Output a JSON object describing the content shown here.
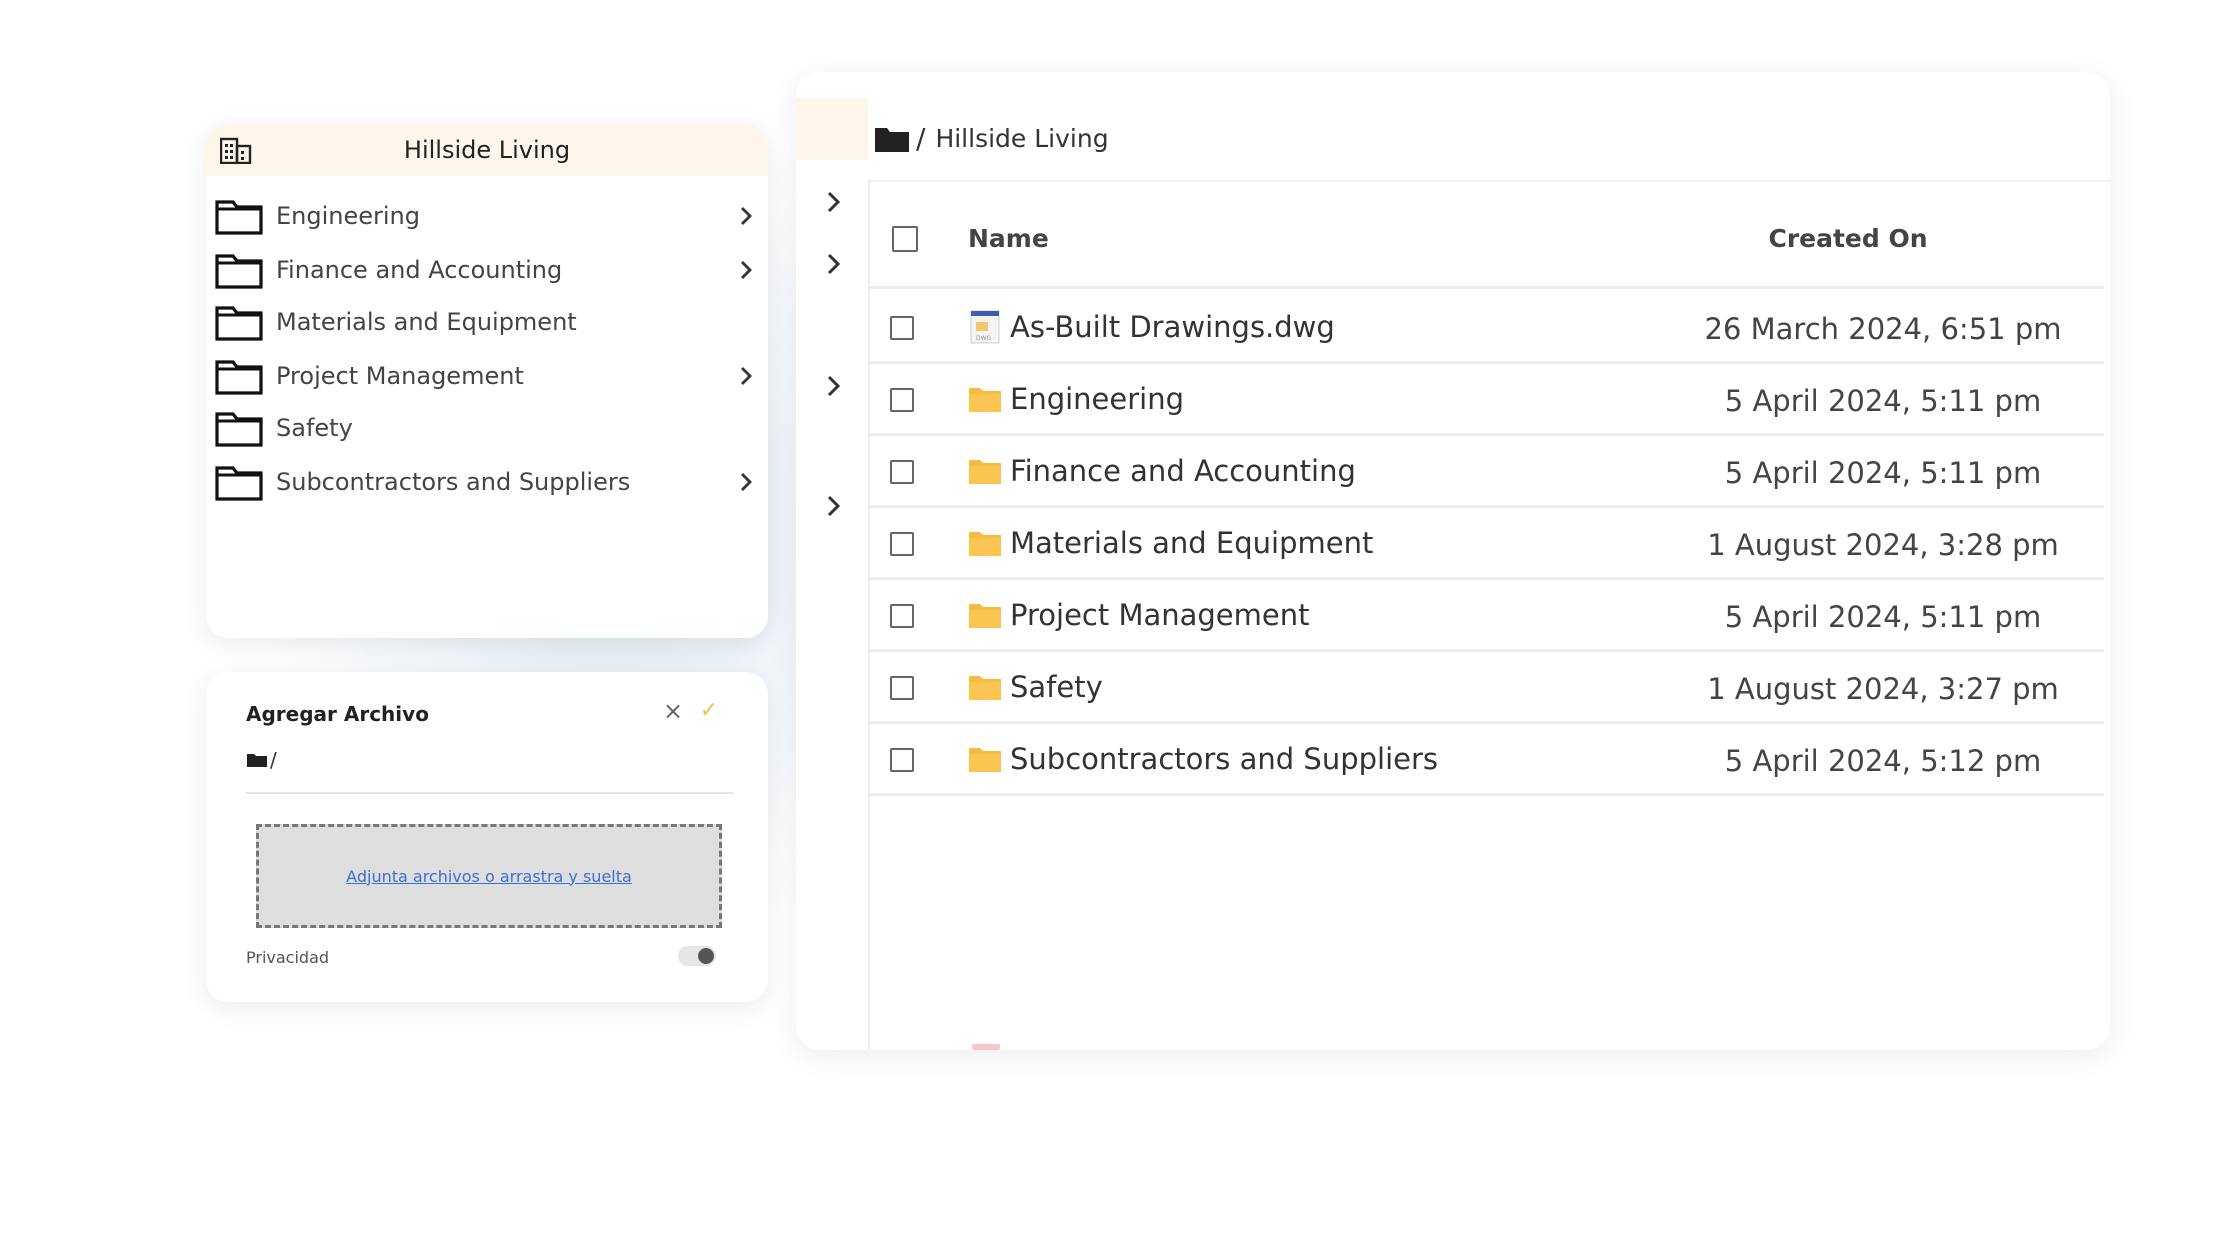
{
  "tree": {
    "root_title": "Hillside Living",
    "items": [
      {
        "label": "Engineering",
        "has_children": true
      },
      {
        "label": "Finance and Accounting",
        "has_children": true
      },
      {
        "label": "Materials and Equipment",
        "has_children": false
      },
      {
        "label": "Project Management",
        "has_children": true
      },
      {
        "label": "Safety",
        "has_children": false
      },
      {
        "label": "Subcontractors and Suppliers",
        "has_children": true
      }
    ]
  },
  "upload": {
    "title": "Agregar Archivo",
    "close_icon": "×",
    "confirm_icon": "✓",
    "path": "/",
    "dropzone_text": "Adjunta archivos o arrastra y suelta",
    "privacy_label": "Privacidad",
    "privacy_enabled": false
  },
  "main": {
    "breadcrumb_sep": "/",
    "breadcrumb_text": "Hillside Living",
    "columns": {
      "name": "Name",
      "created_on": "Created On"
    },
    "rows": [
      {
        "type": "file",
        "icon": "dwg-file-icon",
        "name": "As-Built Drawings.dwg",
        "created_on": "26 March 2024, 6:51 pm"
      },
      {
        "type": "folder",
        "icon": "folder-icon",
        "name": "Engineering",
        "created_on": "5 April 2024, 5:11 pm"
      },
      {
        "type": "folder",
        "icon": "folder-icon",
        "name": "Finance and Accounting",
        "created_on": "5 April 2024, 5:11 pm"
      },
      {
        "type": "folder",
        "icon": "folder-icon",
        "name": "Materials and Equipment",
        "created_on": "1 August 2024, 3:28 pm"
      },
      {
        "type": "folder",
        "icon": "folder-icon",
        "name": "Project Management",
        "created_on": "5 April 2024, 5:11 pm"
      },
      {
        "type": "folder",
        "icon": "folder-icon",
        "name": "Safety",
        "created_on": "1 August 2024, 3:27 pm"
      },
      {
        "type": "folder",
        "icon": "folder-icon",
        "name": "Subcontractors and Suppliers",
        "created_on": "5 April 2024, 5:12 pm"
      }
    ]
  },
  "colors": {
    "accent_folder": "#f7b940",
    "header_tint": "#fdf6ea",
    "confirm": "#f0c24c",
    "link": "#3d6fd1"
  }
}
